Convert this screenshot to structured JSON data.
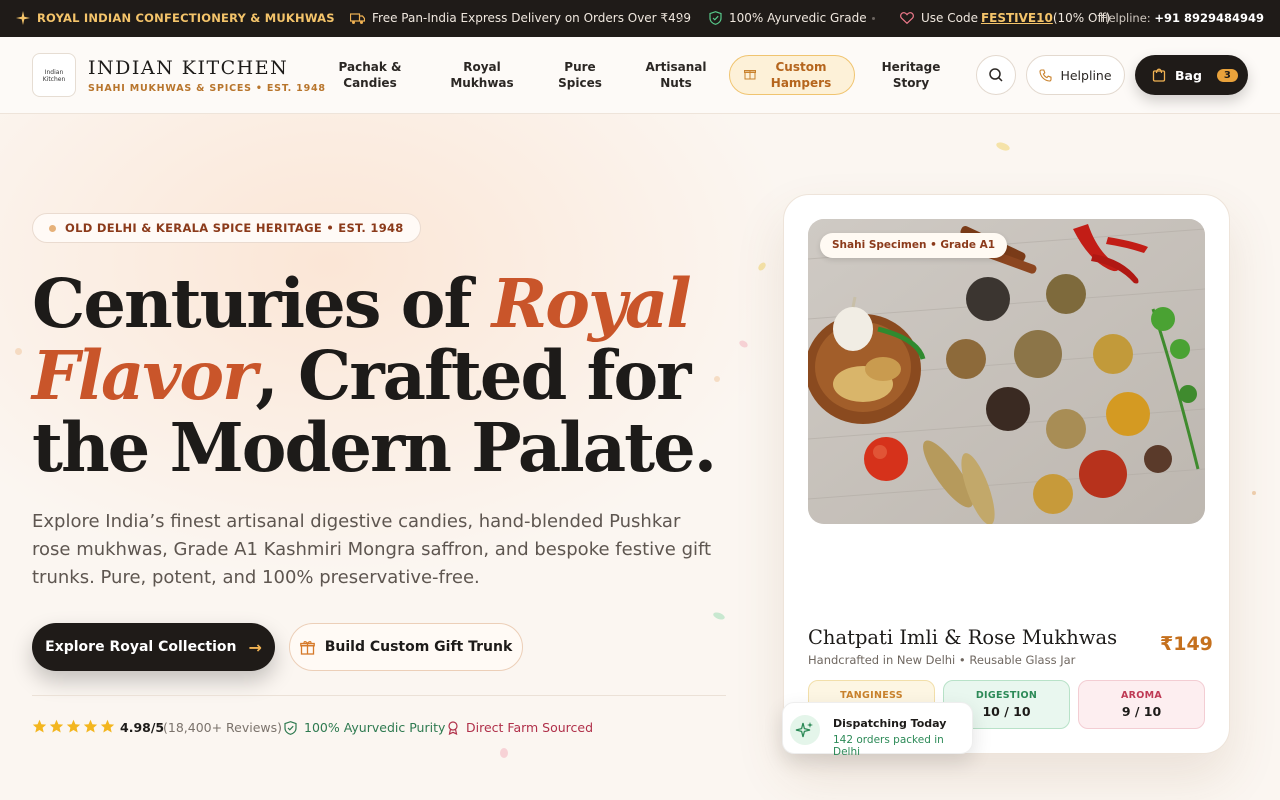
{
  "topbar": {
    "brand": "ROYAL INDIAN CONFECTIONERY & MUKHWAS",
    "delivery": "Free Pan-India Express Delivery on Orders Over ₹499",
    "ayurvedic": "100% Ayurvedic Grade",
    "code_prefix": "Use Code ",
    "code": "FESTIVE10",
    "code_suffix": " (10% Off)",
    "helpline_label": "Helpline: ",
    "helpline_number": "+91 8929484949"
  },
  "nav": {
    "logo_text_1": "Indian",
    "logo_text_2": "Kitchen",
    "brand_title": "INDIAN KITCHEN",
    "brand_sub": "SHAHI MUKHWAS & SPICES • EST. 1948",
    "links": [
      {
        "l1": "Pachak &",
        "l2": "Candies"
      },
      {
        "l1": "Royal",
        "l2": "Mukhwas"
      },
      {
        "l1": "Pure",
        "l2": "Spices"
      },
      {
        "l1": "Artisanal",
        "l2": "Nuts"
      },
      {
        "l1": "Custom",
        "l2": "Hampers"
      },
      {
        "l1": "Heritage",
        "l2": "Story"
      }
    ],
    "helpline_btn": "Helpline",
    "bag_label": "Bag",
    "bag_count": "3"
  },
  "hero": {
    "pill": "OLD DELHI & KERALA SPICE HERITAGE • EST. 1948",
    "h_part1": "Centuries of ",
    "h_accent1": "Royal",
    "h_accent2": "Flavor",
    "h_part2": ", Crafted for",
    "h_part3": "the Modern Palate.",
    "description": "Explore India’s finest artisanal digestive candies, hand-blended Pushkar rose mukhwas, Grade A1 Kashmiri Mongra saffron, and bespoke festive gift trunks. Pure, potent, and 100% preservative-free.",
    "cta_primary": "Explore Royal Collection",
    "cta_secondary": "Build Custom Gift Trunk",
    "rating": "4.98/5",
    "reviews": "(18,400+ Reviews)",
    "trust1": "100% Ayurvedic Purity",
    "trust2": "Direct Farm Sourced"
  },
  "product": {
    "badge": "Shahi Specimen • Grade A1",
    "title": "Chatpati Imli & Rose Mukhwas",
    "subtitle": "Handcrafted in New Delhi • Reusable Glass Jar",
    "price": "₹149",
    "meters": [
      {
        "key": "TANGINESS",
        "value": ""
      },
      {
        "key": "DIGESTION",
        "value": "10 / 10"
      },
      {
        "key": "AROMA",
        "value": "9 / 10"
      }
    ],
    "dispatch_title": "Dispatching Today",
    "dispatch_sub": "142 orders packed in Delhi"
  },
  "colors": {
    "accent": "#c9552a",
    "gold": "#f4c46a",
    "dark": "#1f1b18"
  }
}
